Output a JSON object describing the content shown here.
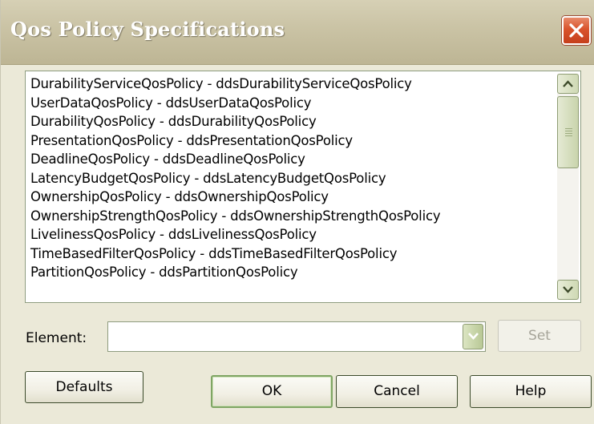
{
  "window": {
    "title": "Qos Policy Specifications",
    "close_icon": "close-icon"
  },
  "policy_list": {
    "items": [
      "DurabilityServiceQosPolicy - ddsDurabilityServiceQosPolicy",
      "UserDataQosPolicy - ddsUserDataQosPolicy",
      "DurabilityQosPolicy - ddsDurabilityQosPolicy",
      "PresentationQosPolicy - ddsPresentationQosPolicy",
      "DeadlineQosPolicy - ddsDeadlineQosPolicy",
      "LatencyBudgetQosPolicy - ddsLatencyBudgetQosPolicy",
      "OwnershipQosPolicy - ddsOwnershipQosPolicy",
      "OwnershipStrengthQosPolicy - ddsOwnershipStrengthQosPolicy",
      "LivelinessQosPolicy - ddsLivelinessQosPolicy",
      "TimeBasedFilterQosPolicy - ddsTimeBasedFilterQosPolicy",
      "PartitionQosPolicy - ddsPartitionQosPolicy"
    ]
  },
  "element": {
    "label": "Element:",
    "value": "",
    "set_label": "Set"
  },
  "buttons": {
    "defaults": "Defaults",
    "ok": "OK",
    "cancel": "Cancel",
    "help": "Help"
  },
  "colors": {
    "dialog_bg": "#ebe9d8",
    "titlebar": "#cbc4a6",
    "close_red": "#d9532c",
    "scroll_green": "#c9d4ac"
  }
}
